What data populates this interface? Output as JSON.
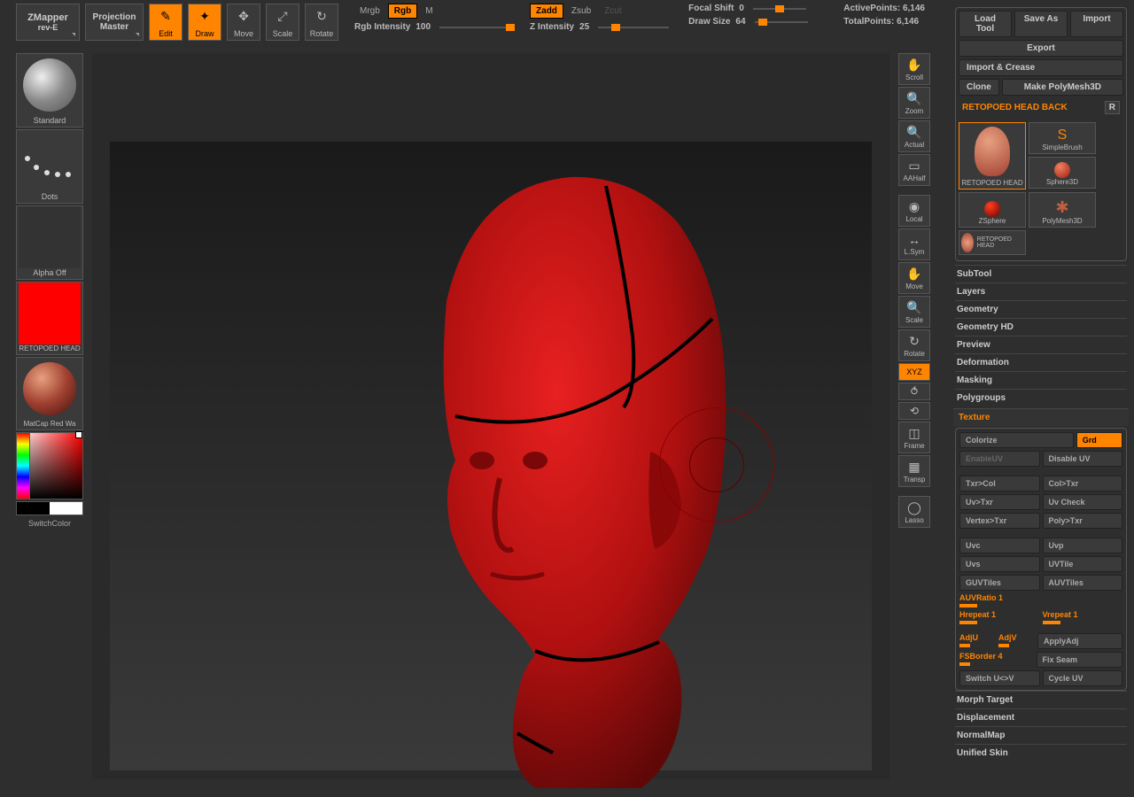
{
  "top": {
    "zmapper_label": "ZMapper",
    "zmapper_sub": "rev-E",
    "projection_label": "Projection",
    "projection_sub": "Master",
    "buttons": {
      "edit": "Edit",
      "draw": "Draw",
      "move": "Move",
      "scale": "Scale",
      "rotate": "Rotate"
    },
    "modes": {
      "mrgb": "Mrgb",
      "rgb": "Rgb",
      "m": "M",
      "zadd": "Zadd",
      "zsub": "Zsub",
      "zcut": "Zcut"
    },
    "sliders": {
      "rgb_intensity_label": "Rgb Intensity",
      "rgb_intensity_value": "100",
      "z_intensity_label": "Z Intensity",
      "z_intensity_value": "25",
      "focal_shift_label": "Focal Shift",
      "focal_shift_value": "0",
      "draw_size_label": "Draw Size",
      "draw_size_value": "64"
    },
    "stats": {
      "active_label": "ActivePoints:",
      "active_value": "6,146",
      "total_label": "TotalPoints:",
      "total_value": "6,146"
    }
  },
  "left_palette": {
    "brush": "Standard",
    "stroke": "Dots",
    "alpha": "Alpha Off",
    "texture": "RETOPOED HEAD",
    "material": "MatCap Red Wa",
    "switch": "SwitchColor"
  },
  "right_tools": {
    "scroll": "Scroll",
    "zoom": "Zoom",
    "actual": "Actual",
    "aahalf": "AAHalf",
    "local": "Local",
    "lsym": "L.Sym",
    "move": "Move",
    "scale": "Scale",
    "rotate": "Rotate",
    "xyz": "XYZ",
    "frame": "Frame",
    "transp": "Transp",
    "lasso": "Lasso"
  },
  "right_panel": {
    "load_tool": "Load Tool",
    "save_as": "Save As",
    "import": "Import",
    "export": "Export",
    "import_crease": "Import & Crease",
    "clone": "Clone",
    "make_poly": "Make PolyMesh3D",
    "tool_title": "RETOPOED HEAD BACK",
    "r": "R",
    "thumbs": {
      "retopoed_head": "RETOPOED HEAD",
      "simplebrush": "SimpleBrush",
      "sphere3d": "Sphere3D",
      "zsphere": "ZSphere",
      "polymesh3d": "PolyMesh3D",
      "retopoed_head2": "RETOPOED HEAD"
    },
    "accordions": {
      "subtool": "SubTool",
      "layers": "Layers",
      "geometry": "Geometry",
      "geometry_hd": "Geometry HD",
      "preview": "Preview",
      "deformation": "Deformation",
      "masking": "Masking",
      "polygroups": "Polygroups",
      "texture": "Texture",
      "morph_target": "Morph Target",
      "displacement": "Displacement",
      "normalmap": "NormalMap",
      "unified_skin": "Unified Skin"
    },
    "texture": {
      "colorize": "Colorize",
      "grd": "Grd",
      "enableuv": "EnableUV",
      "disableuv": "Disable UV",
      "txr_col": "Txr>Col",
      "col_txr": "Col>Txr",
      "uv_txr": "Uv>Txr",
      "uv_check": "Uv Check",
      "vertex_txr": "Vertex>Txr",
      "poly_txr": "Poly>Txr",
      "uvc": "Uvc",
      "uvp": "Uvp",
      "uvs": "Uvs",
      "uvtile": "UVTile",
      "guvtiles": "GUVTiles",
      "auvtiles": "AUVTiles",
      "auvratio": "AUVRatio 1",
      "hrepeat": "Hrepeat 1",
      "vrepeat": "Vrepeat 1",
      "adju": "AdjU",
      "adjv": "AdjV",
      "applyadj": "ApplyAdj",
      "fsborder": "FSBorder 4",
      "fixseam": "Fix Seam",
      "switchuv": "Switch U<>V",
      "cycleuv": "Cycle UV"
    }
  }
}
